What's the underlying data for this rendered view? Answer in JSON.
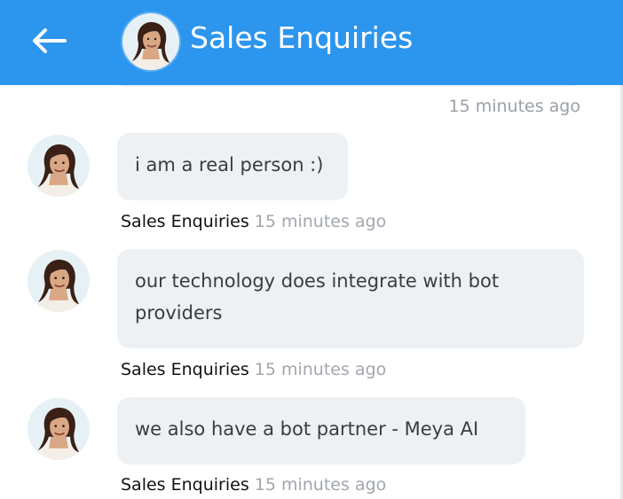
{
  "header": {
    "back_icon": "arrow-left-icon",
    "title": "Sales Enquiries",
    "background": "#2c95ee",
    "avatar_icon": "agent-avatar"
  },
  "top_timestamp": "15 minutes ago",
  "messages": [
    {
      "text": "i am a real person :)",
      "sender": "Sales Enquiries",
      "time": "15 minutes ago"
    },
    {
      "text": "our technology does integrate with bot providers",
      "sender": "Sales Enquiries",
      "time": "15 minutes ago"
    },
    {
      "text": "we also have a bot partner - Meya AI",
      "sender": "Sales Enquiries",
      "time": "15 minutes ago"
    }
  ],
  "colors": {
    "bubble": "#eef1f4",
    "sender_text": "#111111",
    "time_text": "#a2a7ad"
  }
}
